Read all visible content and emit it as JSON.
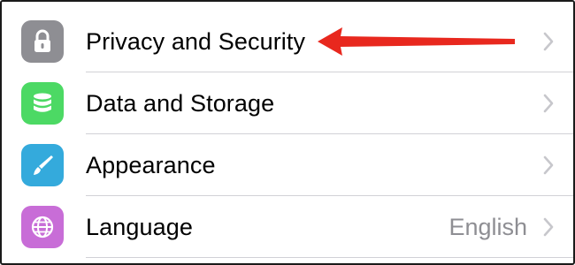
{
  "settings": {
    "items": [
      {
        "label": "Privacy and Security",
        "icon": "lock-icon",
        "icon_bg": "#8e8e93",
        "value": ""
      },
      {
        "label": "Data and Storage",
        "icon": "database-icon",
        "icon_bg": "#4cd964",
        "value": ""
      },
      {
        "label": "Appearance",
        "icon": "brush-icon",
        "icon_bg": "#34aadc",
        "value": ""
      },
      {
        "label": "Language",
        "icon": "globe-icon",
        "icon_bg": "#c86dd7",
        "value": "English"
      }
    ]
  },
  "colors": {
    "annotation_arrow": "#e8281e",
    "chevron": "#c7c7cc",
    "divider": "#d1d1d6",
    "secondary_text": "#8e8e93"
  }
}
